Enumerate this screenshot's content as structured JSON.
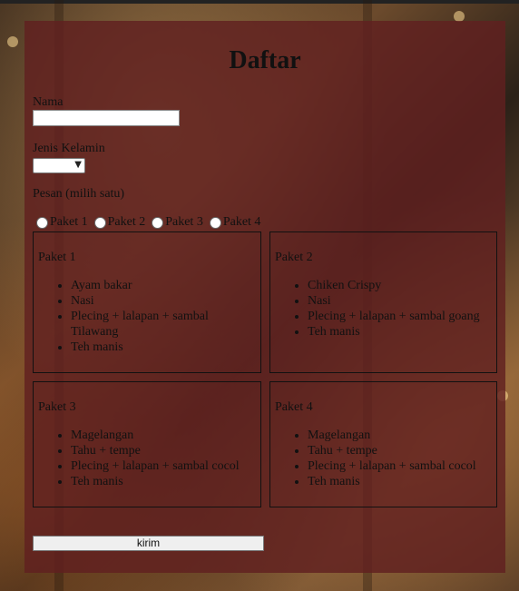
{
  "form": {
    "title": "Daftar",
    "name_label": "Nama",
    "name_value": "",
    "gender_label": "Jenis Kelamin",
    "gender_value": "",
    "order_label": "Pesan (milih satu)",
    "radio_options": [
      "Paket 1",
      "Paket 2",
      "Paket 3",
      "Paket 4"
    ],
    "submit_label": "kirim"
  },
  "packages": [
    {
      "title": "Paket 1",
      "items": [
        "Ayam bakar",
        "Nasi",
        "Plecing + lalapan + sambal Tilawang",
        "Teh manis"
      ]
    },
    {
      "title": "Paket 2",
      "items": [
        "Chiken Crispy",
        "Nasi",
        "Plecing + lalapan + sambal goang",
        "Teh manis"
      ]
    },
    {
      "title": "Paket 3",
      "items": [
        "Magelangan",
        "Tahu + tempe",
        "Plecing + lalapan + sambal cocol",
        "Teh manis"
      ]
    },
    {
      "title": "Paket 4",
      "items": [
        "Magelangan",
        "Tahu + tempe",
        "Plecing + lalapan + sambal cocol",
        "Teh manis"
      ]
    }
  ],
  "colors": {
    "card_overlay": "#602020",
    "text": "#111111"
  }
}
